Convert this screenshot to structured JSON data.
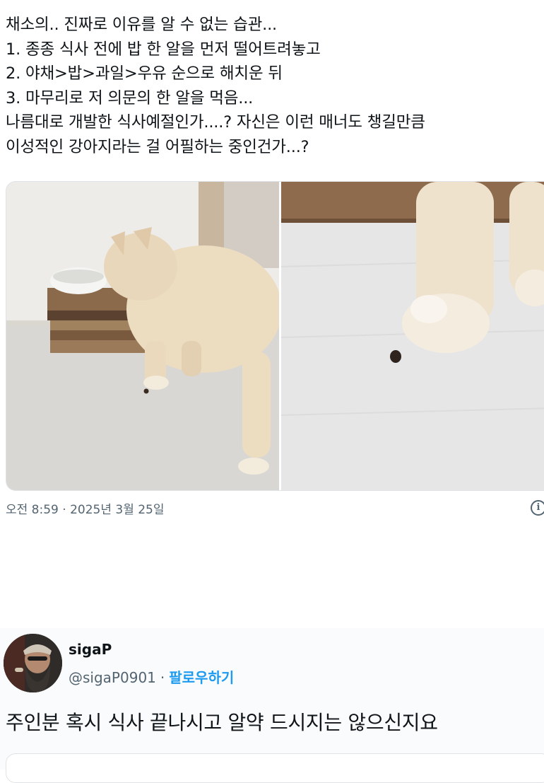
{
  "tweet": {
    "lines": [
      "채소의.. 진짜로 이유를 알 수 없는 습관...",
      "1. 종종 식사 전에 밥 한 알을 먼저 떨어트려놓고",
      "2. 야채>밥>과일>우유 순으로 해치운 뒤",
      "3. 마무리로 저 의문의 한 알을 먹음...",
      "나름대로 개발한 식사예절인가....? 자신은 이런 매너도 챙길만큼",
      "이성적인 강아지라는 걸 어필하는 중인건가...?"
    ],
    "timestamp": "오전 8:59 · 2025년 3월 25일",
    "info_icon": "i",
    "media_icons": [
      "photo-dog-at-bowl",
      "photo-dog-paw-with-kibble"
    ]
  },
  "reply": {
    "username": "sigaP",
    "handle": "@sigaP0901",
    "separator": "·",
    "follow_label": "팔로우하기",
    "text": "주인분 혹시 식사 끝나시고 알약 드시지는 않으신지요"
  },
  "colors": {
    "text": "#0f1419",
    "secondary": "#536471",
    "accent": "#1d9bf0"
  }
}
